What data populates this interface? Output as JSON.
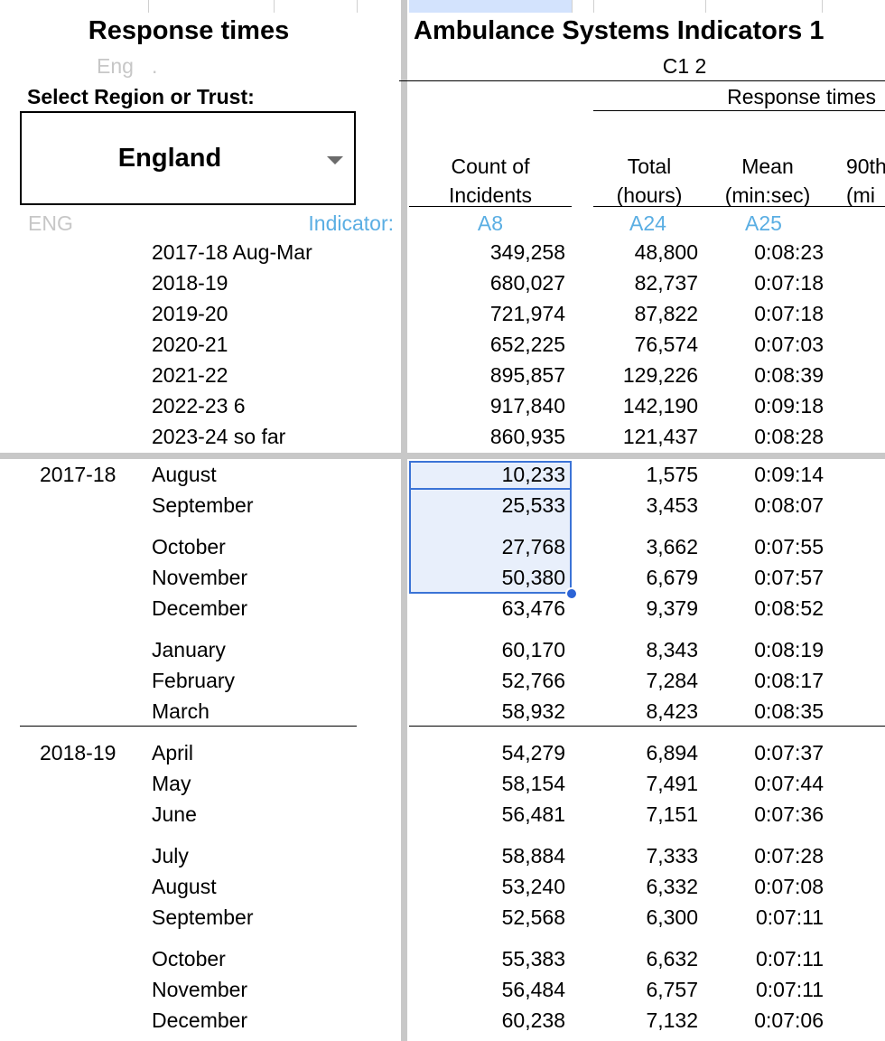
{
  "left_panel": {
    "title": "Response times",
    "region_code_ghost": "Eng",
    "region_code_dot": ".",
    "select_label": "Select Region or Trust:",
    "dropdown_value": "England",
    "area_code": "ENG",
    "indicator_label": "Indicator:"
  },
  "right_panel": {
    "title": "Ambulance Systems Indicators 1",
    "subtitle": "C1 2",
    "group_header": "Response times",
    "columns": [
      {
        "label_line1": "Count of",
        "label_line2": "Incidents",
        "code": "A8"
      },
      {
        "label_line1": "Total",
        "label_line2": "(hours)",
        "code": "A24"
      },
      {
        "label_line1": "Mean",
        "label_line2": "(min:sec)",
        "code": "A25"
      },
      {
        "label_line1": "90th",
        "label_line2": "(mi",
        "code": ""
      }
    ]
  },
  "annual_rows": [
    {
      "period": "2017-18 Aug-Mar",
      "count": "349,258",
      "total": "48,800",
      "mean": "0:08:23"
    },
    {
      "period": "2018-19",
      "count": "680,027",
      "total": "82,737",
      "mean": "0:07:18"
    },
    {
      "period": "2019-20",
      "count": "721,974",
      "total": "87,822",
      "mean": "0:07:18"
    },
    {
      "period": "2020-21",
      "count": "652,225",
      "total": "76,574",
      "mean": "0:07:03"
    },
    {
      "period": "2021-22",
      "count": "895,857",
      "total": "129,226",
      "mean": "0:08:39"
    },
    {
      "period": "2022-23 6",
      "count": "917,840",
      "total": "142,190",
      "mean": "0:09:18"
    },
    {
      "period": "2023-24 so far",
      "count": "860,935",
      "total": "121,437",
      "mean": "0:08:28"
    }
  ],
  "monthly_rows": [
    {
      "year": "2017-18",
      "month": "August",
      "count": "10,233",
      "total": "1,575",
      "mean": "0:09:14"
    },
    {
      "year": "",
      "month": "September",
      "count": "25,533",
      "total": "3,453",
      "mean": "0:08:07"
    },
    {
      "year": "",
      "month": "October",
      "count": "27,768",
      "total": "3,662",
      "mean": "0:07:55"
    },
    {
      "year": "",
      "month": "November",
      "count": "50,380",
      "total": "6,679",
      "mean": "0:07:57"
    },
    {
      "year": "",
      "month": "December",
      "count": "63,476",
      "total": "9,379",
      "mean": "0:08:52"
    },
    {
      "year": "",
      "month": "January",
      "count": "60,170",
      "total": "8,343",
      "mean": "0:08:19"
    },
    {
      "year": "",
      "month": "February",
      "count": "52,766",
      "total": "7,284",
      "mean": "0:08:17"
    },
    {
      "year": "",
      "month": "March",
      "count": "58,932",
      "total": "8,423",
      "mean": "0:08:35"
    },
    {
      "year": "2018-19",
      "month": "April",
      "count": "54,279",
      "total": "6,894",
      "mean": "0:07:37"
    },
    {
      "year": "",
      "month": "May",
      "count": "58,154",
      "total": "7,491",
      "mean": "0:07:44"
    },
    {
      "year": "",
      "month": "June",
      "count": "56,481",
      "total": "7,151",
      "mean": "0:07:36"
    },
    {
      "year": "",
      "month": "July",
      "count": "58,884",
      "total": "7,333",
      "mean": "0:07:28"
    },
    {
      "year": "",
      "month": "August",
      "count": "53,240",
      "total": "6,332",
      "mean": "0:07:08"
    },
    {
      "year": "",
      "month": "September",
      "count": "52,568",
      "total": "6,300",
      "mean": "0:07:11"
    },
    {
      "year": "",
      "month": "October",
      "count": "55,383",
      "total": "6,632",
      "mean": "0:07:11"
    },
    {
      "year": "",
      "month": "November",
      "count": "56,484",
      "total": "6,757",
      "mean": "0:07:11"
    },
    {
      "year": "",
      "month": "December",
      "count": "60,238",
      "total": "7,132",
      "mean": "0:07:06"
    }
  ],
  "colors": {
    "indicator_blue": "#5aaee3",
    "selection_border": "#3b73d6",
    "selection_fill": "#e8effb",
    "freeze_bar": "#c8c8c8"
  }
}
